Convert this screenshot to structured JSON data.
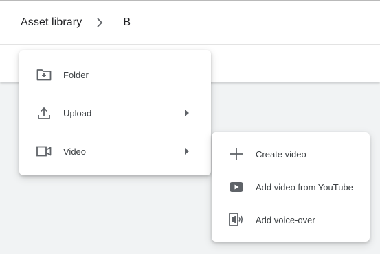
{
  "breadcrumb": {
    "root_label": "Asset library",
    "current_label": "B",
    "separator_icon": "chevron-right-icon"
  },
  "new_menu": {
    "items": [
      {
        "label": "Folder",
        "icon": "folder-add-icon",
        "has_submenu": false
      },
      {
        "label": "Upload",
        "icon": "upload-icon",
        "has_submenu": true
      },
      {
        "label": "Video",
        "icon": "video-camera-icon",
        "has_submenu": true
      }
    ]
  },
  "video_submenu": {
    "items": [
      {
        "label": "Create video",
        "icon": "plus-icon"
      },
      {
        "label": "Add video from YouTube",
        "icon": "youtube-play-icon"
      },
      {
        "label": "Add voice-over",
        "icon": "voice-over-icon"
      }
    ]
  },
  "colors": {
    "icon": "#5f6368",
    "text": "#3c4043",
    "background": "#f1f3f4",
    "surface": "#ffffff"
  }
}
